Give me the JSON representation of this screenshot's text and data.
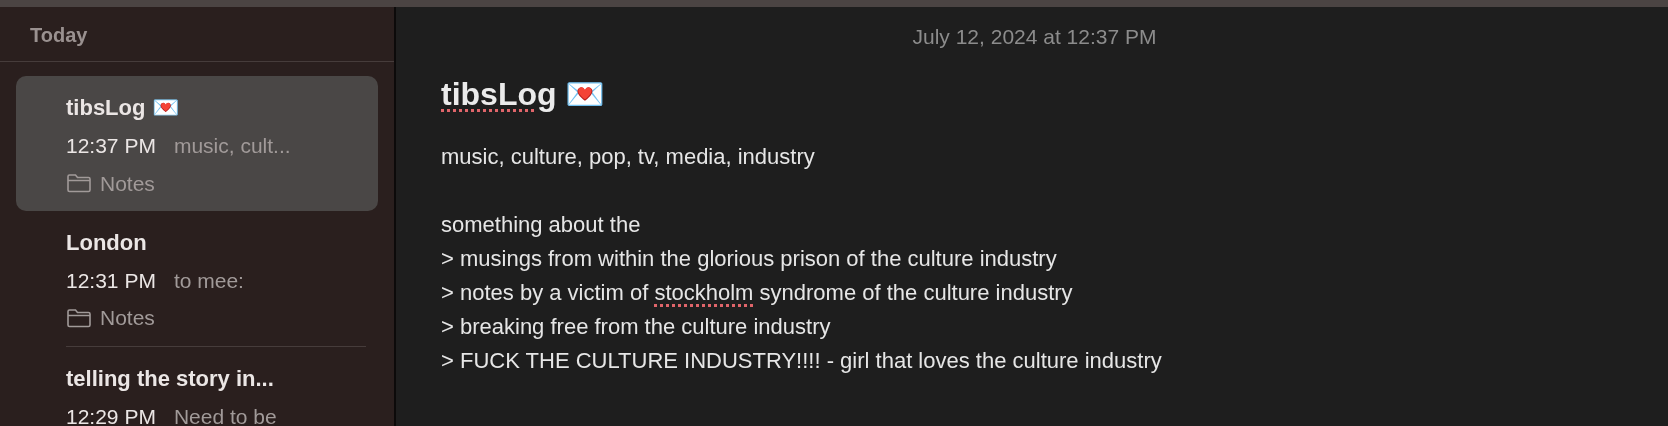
{
  "sidebar": {
    "section_title": "Today",
    "notes": [
      {
        "title": "tibsLog 💌",
        "time": "12:37 PM",
        "preview": "music, cult...",
        "folder": "Notes",
        "selected": true
      },
      {
        "title": "London",
        "time": "12:31 PM",
        "preview": "to mee:",
        "folder": "Notes",
        "selected": false
      },
      {
        "title": "telling the story in...",
        "time": "12:29 PM",
        "preview": "Need to be",
        "selected": false
      }
    ]
  },
  "note": {
    "date": "July 12, 2024 at 12:37 PM",
    "title": [
      {
        "text": "tibsLog",
        "misspelled": true
      },
      {
        "text": " 💌",
        "misspelled": false
      }
    ],
    "lines": [
      [
        {
          "text": "music, culture, pop, tv, media, industry",
          "misspelled": false
        }
      ],
      [
        {
          "text": "something about the",
          "misspelled": false,
          "blank_before": true
        }
      ],
      [
        {
          "text": "> musings from within the glorious prison of the culture industry",
          "misspelled": false
        }
      ],
      [
        {
          "text": "> notes by a victim of ",
          "misspelled": false
        },
        {
          "text": "stockholm",
          "misspelled": true
        },
        {
          "text": " syndrome of the culture industry",
          "misspelled": false
        }
      ],
      [
        {
          "text": "> breaking free from the culture industry",
          "misspelled": false
        }
      ],
      [
        {
          "text": "> FUCK THE CULTURE INDUSTRY!!!! - girl that loves the culture industry",
          "misspelled": false
        }
      ]
    ]
  }
}
